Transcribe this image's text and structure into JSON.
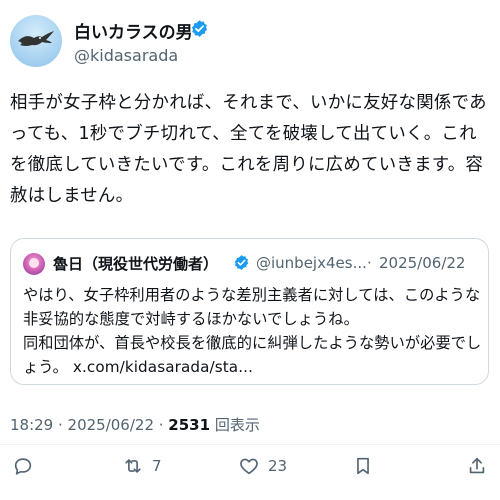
{
  "author": {
    "name": "白いカラスの男",
    "handle": "@kidasarada",
    "verified": true
  },
  "tweet": {
    "text": "相手が女子枠と分かれば、それまで、いかに友好な関係であっても、1秒でブチ切れて、全てを破壊して出ていく。これを徹底していきたいです。これを周りに広めていきます。容赦はしません。"
  },
  "quote": {
    "name": "魯日（現役世代労働者）",
    "handle": "@iunbejx4es...",
    "separator": "·",
    "date": "2025/06/22",
    "text": "やはり、女子枠利用者のような差別主義者に対しては、このような非妥協的な態度で対峙するほかないでしょうね。\n同和団体が、首長や校長を徹底的に糾弾したような勢いが必要でしょう。 x.com/kidasarada/sta..."
  },
  "meta": {
    "time_date": "18:29 · 2025/06/22 · ",
    "views": "2531",
    "views_label": " 回表示"
  },
  "actions": {
    "reply_icon": "reply-icon",
    "retweet_count": "7",
    "like_count": "23",
    "bookmark_icon": "bookmark-icon",
    "share_icon": "share-icon"
  },
  "colors": {
    "verified": "#1d9bf0",
    "secondary_text": "#536471",
    "border": "#cfd9de"
  }
}
